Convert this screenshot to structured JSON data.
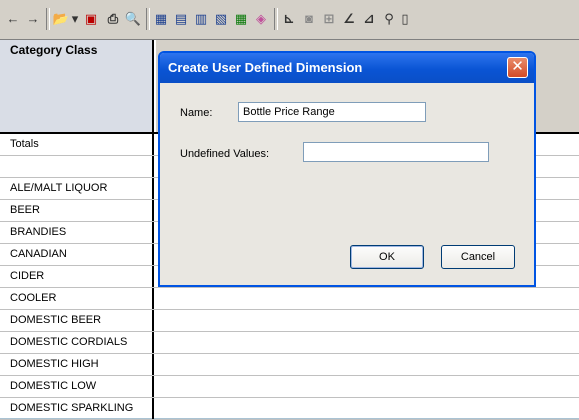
{
  "toolbar": {
    "icons": [
      {
        "name": "back-arrow-icon",
        "glyph": "←"
      },
      {
        "name": "forward-arrow-icon",
        "glyph": "→"
      },
      {
        "name": "open-folder-icon",
        "glyph": "📂"
      },
      {
        "name": "dropdown-arrow-icon",
        "glyph": "▾"
      },
      {
        "name": "save-icon",
        "glyph": "▣"
      },
      {
        "name": "print-icon",
        "glyph": "⎙"
      },
      {
        "name": "print-preview-icon",
        "glyph": "🔍"
      },
      {
        "name": "grid-icon",
        "glyph": "▦"
      },
      {
        "name": "table-icon",
        "glyph": "▤"
      },
      {
        "name": "insert-row-icon",
        "glyph": "▥"
      },
      {
        "name": "insert-column-icon",
        "glyph": "▧"
      },
      {
        "name": "spreadsheet-icon",
        "glyph": "▦"
      },
      {
        "name": "colors-icon",
        "glyph": "◈"
      },
      {
        "name": "chart-axis-icon",
        "glyph": "⊾"
      },
      {
        "name": "camera-icon",
        "glyph": "◙"
      },
      {
        "name": "tree-icon",
        "glyph": "⊞"
      },
      {
        "name": "line-chart-icon",
        "glyph": "∠"
      },
      {
        "name": "area-chart-icon",
        "glyph": "⊿"
      },
      {
        "name": "find-binoculars-icon",
        "glyph": "⚲"
      },
      {
        "name": "more-icon",
        "glyph": "▯"
      }
    ]
  },
  "grid": {
    "category_header": "Category Class",
    "rows": [
      "Totals",
      "",
      "ALE/MALT LIQUOR",
      "BEER",
      "BRANDIES",
      "CANADIAN",
      "CIDER",
      "COOLER",
      "DOMESTIC BEER",
      "DOMESTIC CORDIALS",
      "DOMESTIC HIGH",
      "DOMESTIC LOW",
      "DOMESTIC SPARKLING"
    ]
  },
  "dialog": {
    "title": "Create User Defined Dimension",
    "close_glyph": "✕",
    "name_label": "Name:",
    "name_value": "Bottle Price Range",
    "undefined_label": "Undefined Values:",
    "undefined_value": "",
    "ok_label": "OK",
    "cancel_label": "Cancel"
  }
}
